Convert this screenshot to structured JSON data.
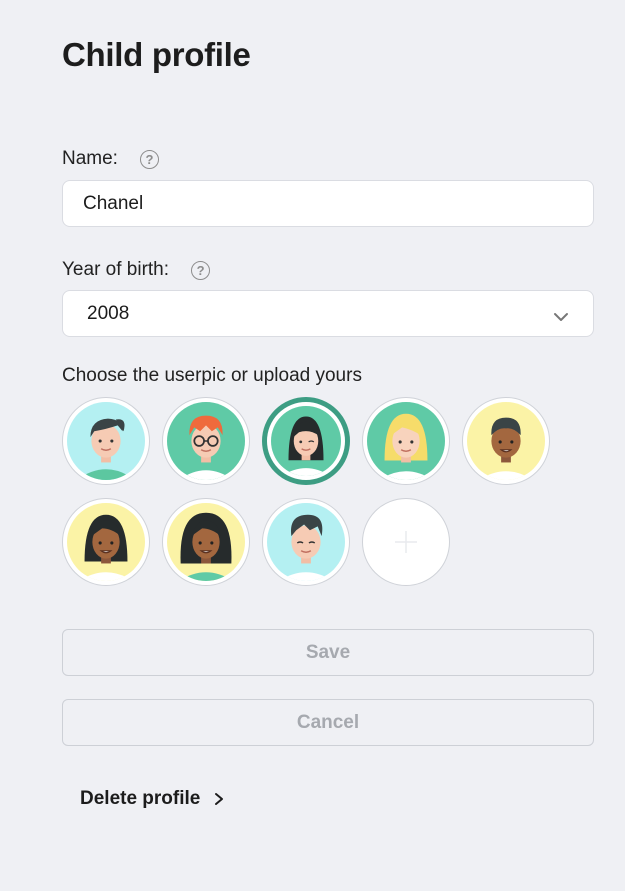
{
  "page": {
    "title": "Child profile"
  },
  "name_field": {
    "label": "Name:",
    "value": "Chanel",
    "help_icon": "question-circle-icon"
  },
  "birth_field": {
    "label": "Year of birth:",
    "value": "2008",
    "help_icon": "question-circle-icon",
    "dropdown_icon": "chevron-down-icon"
  },
  "avatars": {
    "label": "Choose the userpic or upload yours",
    "items": [
      {
        "name": "avatar-boy-dark-hair-cyan",
        "selected": false
      },
      {
        "name": "avatar-boy-red-hair-glasses",
        "selected": false
      },
      {
        "name": "avatar-girl-black-hair",
        "selected": true
      },
      {
        "name": "avatar-girl-blonde-hair",
        "selected": false
      },
      {
        "name": "avatar-boy-dark-skin-yellow",
        "selected": false
      },
      {
        "name": "avatar-girl-dark-skin-yellow",
        "selected": false
      },
      {
        "name": "avatar-girl-curly-hair-yellow",
        "selected": false
      },
      {
        "name": "avatar-boy-quiff-cyan",
        "selected": false
      }
    ],
    "upload_icon": "plus-icon"
  },
  "actions": {
    "save_label": "Save",
    "cancel_label": "Cancel",
    "delete_label": "Delete profile"
  },
  "colors": {
    "background": "#eff0f4",
    "selected_ring": "#3d9d83",
    "disabled_text": "#a6a9af"
  }
}
